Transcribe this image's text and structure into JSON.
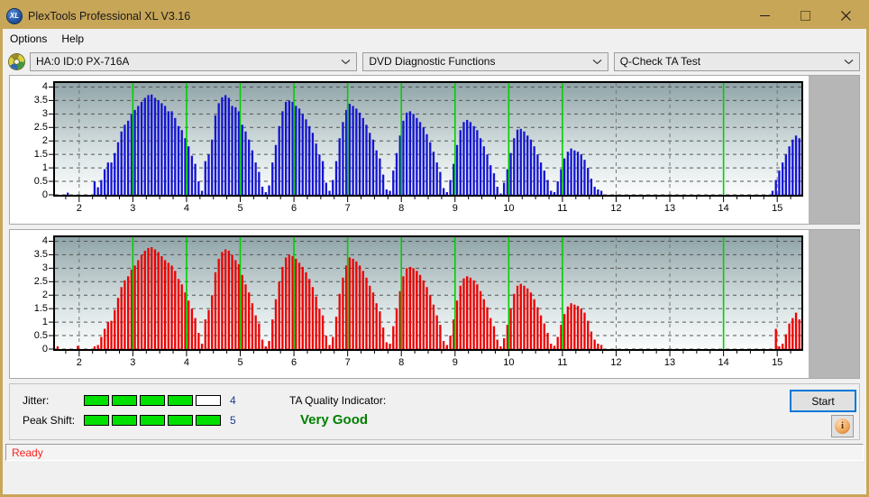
{
  "window": {
    "title": "PlexTools Professional XL V3.16",
    "app_icon": "xl-badge-icon",
    "minimize_label": "–",
    "maximize_label": "□",
    "close_label": "✕"
  },
  "menu": {
    "items": [
      {
        "label": "Options"
      },
      {
        "label": "Help"
      }
    ]
  },
  "toolbar": {
    "drive_icon": "disc-icon",
    "drive": "HA:0 ID:0  PX-716A",
    "function": "DVD Diagnostic Functions",
    "test": "Q-Check TA Test"
  },
  "results": {
    "jitter_label": "Jitter:",
    "jitter_value": "4",
    "jitter_filled": 4,
    "jitter_total": 5,
    "peak_shift_label": "Peak Shift:",
    "peak_shift_value": "5",
    "peak_shift_filled": 5,
    "peak_shift_total": 5,
    "ta_label": "TA Quality Indicator:",
    "ta_value": "Very Good",
    "ta_color": "#008000",
    "start_label": "Start",
    "info_label": "i"
  },
  "statusbar": {
    "text": "Ready"
  },
  "chart_data": [
    {
      "type": "bar",
      "title": "Jitter Histogram",
      "series_name": "Jitter",
      "color": "#1414d2",
      "xlabel": "",
      "ylabel": "",
      "xlim": [
        1.55,
        15.45
      ],
      "ylim": [
        0,
        4.15
      ],
      "yticks": [
        0,
        0.5,
        1,
        1.5,
        2,
        2.5,
        3,
        3.5,
        4
      ],
      "ytick_labels": [
        "0",
        "0.5",
        "1",
        "1.5",
        "2",
        "2.5",
        "3",
        "3.5",
        "4"
      ],
      "xticks": [
        2,
        3,
        4,
        5,
        6,
        7,
        8,
        9,
        10,
        11,
        12,
        13,
        14,
        15
      ],
      "xtick_labels": [
        "2",
        "3",
        "4",
        "5",
        "6",
        "7",
        "8",
        "9",
        "10",
        "11",
        "12",
        "13",
        "14",
        "15"
      ],
      "grid": true,
      "markers": [
        3,
        4,
        5,
        6,
        7,
        8,
        9,
        10,
        11,
        14
      ],
      "marker_color": "#00d000",
      "bar_step": 0.0625,
      "x_start": 1.6,
      "values": [
        0,
        0,
        0,
        0.08,
        0,
        0,
        0,
        0,
        0,
        0,
        0,
        0.5,
        0.28,
        0.55,
        0.95,
        1.2,
        1.2,
        1.55,
        1.95,
        2.35,
        2.6,
        2.75,
        3.0,
        3.15,
        3.3,
        3.45,
        3.6,
        3.7,
        3.72,
        3.6,
        3.5,
        3.4,
        3.3,
        3.1,
        3.1,
        2.85,
        2.55,
        2.4,
        2.1,
        1.8,
        1.45,
        1.15,
        0.5,
        0.15,
        1.25,
        1.5,
        2.05,
        2.95,
        3.4,
        3.62,
        3.7,
        3.6,
        3.3,
        3.25,
        3.1,
        2.6,
        2.35,
        2.05,
        1.65,
        1.2,
        0.85,
        0.3,
        0.1,
        0.35,
        1.2,
        1.85,
        2.55,
        3.1,
        3.45,
        3.5,
        3.45,
        3.3,
        3.2,
        3.0,
        2.8,
        2.55,
        2.3,
        1.9,
        1.5,
        1.25,
        0.45,
        0.15,
        0.55,
        1.25,
        2.1,
        2.7,
        3.15,
        3.38,
        3.3,
        3.2,
        3.05,
        2.85,
        2.6,
        2.3,
        2.05,
        1.65,
        1.35,
        0.75,
        0.2,
        0.15,
        0.9,
        1.55,
        2.2,
        2.75,
        3.05,
        3.1,
        3.0,
        2.85,
        2.7,
        2.5,
        2.25,
        1.95,
        1.6,
        1.2,
        0.85,
        0.25,
        0.1,
        0.55,
        1.15,
        1.85,
        2.4,
        2.7,
        2.78,
        2.7,
        2.55,
        2.4,
        2.1,
        1.8,
        1.5,
        1.1,
        0.8,
        0.3,
        0.05,
        0.45,
        0.95,
        1.55,
        2.1,
        2.42,
        2.45,
        2.35,
        2.2,
        2.05,
        1.8,
        1.5,
        1.2,
        0.9,
        0.55,
        0.15,
        0.1,
        0.5,
        0.95,
        1.35,
        1.6,
        1.72,
        1.65,
        1.6,
        1.5,
        1.3,
        1.0,
        0.6,
        0.3,
        0.2,
        0.15,
        0,
        0,
        0,
        0,
        0,
        0,
        0,
        0,
        0,
        0,
        0,
        0,
        0,
        0,
        0,
        0,
        0,
        0,
        0,
        0,
        0,
        0,
        0,
        0,
        0,
        0,
        0,
        0,
        0,
        0,
        0,
        0,
        0,
        0,
        0,
        0,
        0,
        0,
        0,
        0,
        0,
        0,
        0,
        0,
        0,
        0,
        0,
        0,
        0,
        0,
        0.15,
        0.55,
        0.9,
        1.2,
        1.5,
        1.8,
        2.05,
        2.2,
        2.1,
        2.0,
        1.85,
        1.55,
        1.2,
        0.85,
        0.5,
        0.2,
        0,
        0,
        0,
        0,
        0,
        0,
        0,
        0,
        0,
        0,
        0,
        0,
        0,
        0,
        0,
        0,
        0,
        0
      ]
    },
    {
      "type": "bar",
      "title": "Peak Shift Histogram",
      "series_name": "Peak Shift",
      "color": "#ee0000",
      "xlabel": "",
      "ylabel": "",
      "xlim": [
        1.55,
        15.45
      ],
      "ylim": [
        0,
        4.15
      ],
      "yticks": [
        0,
        0.5,
        1,
        1.5,
        2,
        2.5,
        3,
        3.5,
        4
      ],
      "ytick_labels": [
        "0",
        "0.5",
        "1",
        "1.5",
        "2",
        "2.5",
        "3",
        "3.5",
        "4"
      ],
      "xticks": [
        2,
        3,
        4,
        5,
        6,
        7,
        8,
        9,
        10,
        11,
        12,
        13,
        14,
        15
      ],
      "xtick_labels": [
        "2",
        "3",
        "4",
        "5",
        "6",
        "7",
        "8",
        "9",
        "10",
        "11",
        "12",
        "13",
        "14",
        "15"
      ],
      "grid": true,
      "markers": [
        3,
        4,
        5,
        6,
        7,
        8,
        9,
        10,
        11,
        14
      ],
      "marker_color": "#00d000",
      "bar_step": 0.0625,
      "x_start": 1.6,
      "values": [
        0.1,
        0,
        0,
        0,
        0,
        0,
        0.12,
        0,
        0,
        0,
        0,
        0.1,
        0.15,
        0.45,
        0.75,
        1.0,
        1.05,
        1.45,
        1.9,
        2.3,
        2.55,
        2.7,
        2.95,
        3.1,
        3.3,
        3.5,
        3.65,
        3.75,
        3.78,
        3.7,
        3.6,
        3.45,
        3.3,
        3.2,
        3.1,
        2.9,
        2.6,
        2.4,
        2.1,
        1.8,
        1.5,
        1.15,
        0.6,
        0.2,
        1.1,
        1.45,
        2.0,
        2.85,
        3.35,
        3.6,
        3.7,
        3.65,
        3.5,
        3.3,
        3.15,
        2.75,
        2.4,
        2.1,
        1.7,
        1.25,
        0.95,
        0.35,
        0.1,
        0.3,
        1.1,
        1.85,
        2.5,
        3.05,
        3.4,
        3.5,
        3.45,
        3.35,
        3.2,
        3.05,
        2.85,
        2.6,
        2.3,
        1.95,
        1.5,
        1.25,
        0.5,
        0.15,
        0.45,
        1.2,
        2.05,
        2.65,
        3.1,
        3.4,
        3.35,
        3.25,
        3.1,
        2.9,
        2.65,
        2.35,
        2.1,
        1.7,
        1.4,
        0.8,
        0.25,
        0.2,
        0.85,
        1.5,
        2.15,
        2.7,
        3.0,
        3.05,
        3.0,
        2.9,
        2.75,
        2.55,
        2.3,
        2.0,
        1.65,
        1.25,
        0.9,
        0.3,
        0.15,
        0.5,
        1.1,
        1.8,
        2.35,
        2.62,
        2.7,
        2.65,
        2.55,
        2.4,
        2.15,
        1.85,
        1.55,
        1.15,
        0.85,
        0.35,
        0.1,
        0.4,
        0.9,
        1.5,
        2.05,
        2.35,
        2.42,
        2.35,
        2.25,
        2.1,
        1.85,
        1.55,
        1.25,
        0.95,
        0.6,
        0.2,
        0.12,
        0.45,
        0.9,
        1.3,
        1.58,
        1.7,
        1.65,
        1.6,
        1.5,
        1.35,
        1.05,
        0.65,
        0.35,
        0.2,
        0.15,
        0,
        0,
        0,
        0,
        0,
        0,
        0,
        0,
        0,
        0,
        0,
        0,
        0,
        0,
        0,
        0,
        0,
        0,
        0,
        0,
        0,
        0,
        0,
        0,
        0,
        0,
        0,
        0,
        0,
        0,
        0,
        0,
        0,
        0,
        0,
        0,
        0,
        0,
        0,
        0,
        0,
        0,
        0,
        0,
        0,
        0,
        0,
        0,
        0,
        0,
        0,
        0.75,
        0.1,
        0.2,
        0.55,
        0.95,
        1.15,
        1.35,
        1.1,
        1.2,
        0.95,
        0.8,
        0.8,
        0.8,
        0,
        0,
        0,
        0,
        0,
        0,
        0,
        0,
        0,
        0,
        0,
        0,
        0,
        0,
        0,
        0,
        0,
        0,
        0,
        0
      ]
    }
  ]
}
